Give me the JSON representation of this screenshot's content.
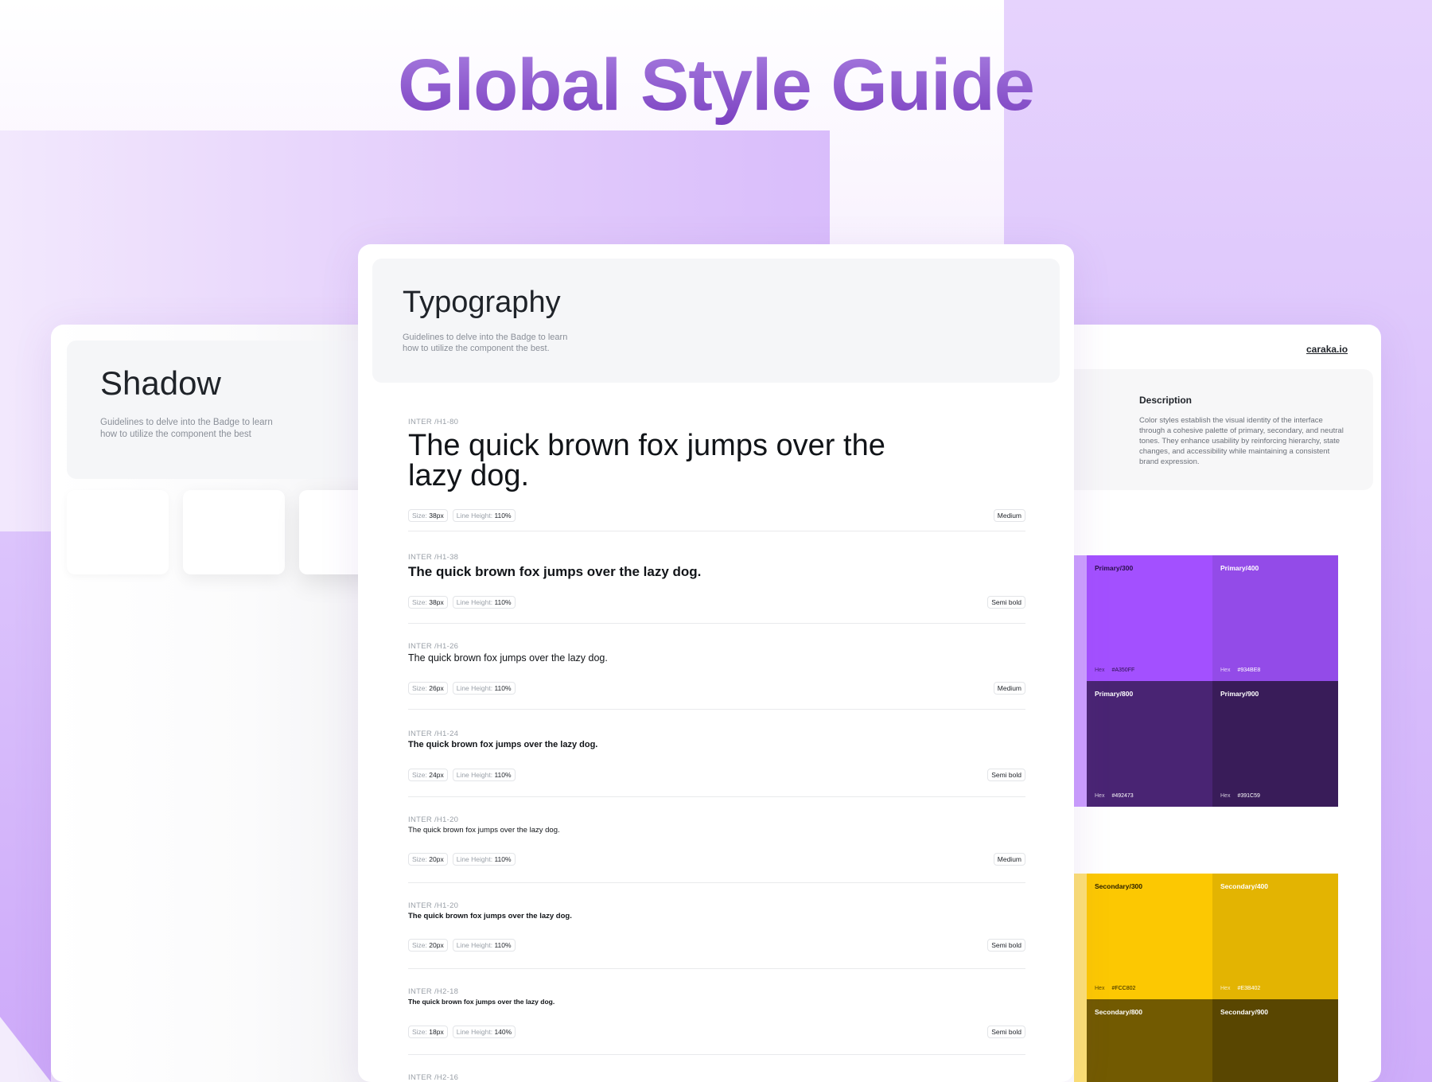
{
  "page_title": "Global Style Guide",
  "shadow": {
    "title": "Shadow",
    "description": "Guidelines to delve into the Badge to learn how to utilize the component the best"
  },
  "typography": {
    "title": "Typography",
    "description": "Guidelines to delve into the Badge to learn how to utilize the component the best.",
    "size_key": "Size:",
    "line_height_key": "Line Height:",
    "specs": [
      {
        "label": "INTER /H1-80",
        "sample": "The quick brown fox jumps over the lazy dog.",
        "size": "38px",
        "line_height": "110%",
        "weight": "Medium"
      },
      {
        "label": "INTER /H1-38",
        "sample": "The quick brown fox jumps over the lazy dog.",
        "size": "38px",
        "line_height": "110%",
        "weight": "Semi bold"
      },
      {
        "label": "INTER /H1-26",
        "sample": "The quick brown fox jumps over the lazy dog.",
        "size": "26px",
        "line_height": "110%",
        "weight": "Medium"
      },
      {
        "label": "INTER /H1-24",
        "sample": "The quick brown fox jumps over the lazy dog.",
        "size": "24px",
        "line_height": "110%",
        "weight": "Semi bold"
      },
      {
        "label": "INTER /H1-20",
        "sample": "The quick brown fox jumps over the lazy dog.",
        "size": "20px",
        "line_height": "110%",
        "weight": "Medium"
      },
      {
        "label": "INTER /H1-20",
        "sample": "The quick brown fox jumps over the lazy dog.",
        "size": "20px",
        "line_height": "110%",
        "weight": "Semi bold"
      },
      {
        "label": "INTER /H2-18",
        "sample": "The quick brown fox jumps over the lazy dog.",
        "size": "18px",
        "line_height": "140%",
        "weight": "Semi bold"
      },
      {
        "label": "INTER /H2-16"
      }
    ]
  },
  "colors": {
    "site_link": "caraka.io",
    "description_title": "Description",
    "description_text": "Color styles establish the visual identity of the interface through a cohesive palette of primary, secondary, and neutral tones. They enhance usability by reinforcing hierarchy, state changes, and accessibility while maintaining a consistent brand expression.",
    "hex_key": "Hex",
    "primary": [
      {
        "name": "Primary/300",
        "hex": "#A350FF",
        "color": "#A350FF",
        "text": "#2a0f4a"
      },
      {
        "name": "Primary/400",
        "hex": "#934BE8",
        "color": "#934BE8",
        "text": "#ffffff"
      },
      {
        "name": "Primary/800",
        "hex": "#492473",
        "color": "#492473",
        "text": "#ffffff"
      },
      {
        "name": "Primary/900",
        "hex": "#391C59",
        "color": "#391C59",
        "text": "#ffffff"
      }
    ],
    "secondary": [
      {
        "name": "Secondary/300",
        "hex": "#FCC802",
        "color": "#FCC802",
        "text": "#2b2200"
      },
      {
        "name": "Secondary/400",
        "hex": "#E3B402",
        "color": "#E3B402",
        "text": "#ffffff"
      },
      {
        "name": "Secondary/800",
        "hex": "",
        "color": "#725A01",
        "text": "#ffffff"
      },
      {
        "name": "Secondary/900",
        "hex": "",
        "color": "#594601",
        "text": "#ffffff"
      }
    ]
  }
}
